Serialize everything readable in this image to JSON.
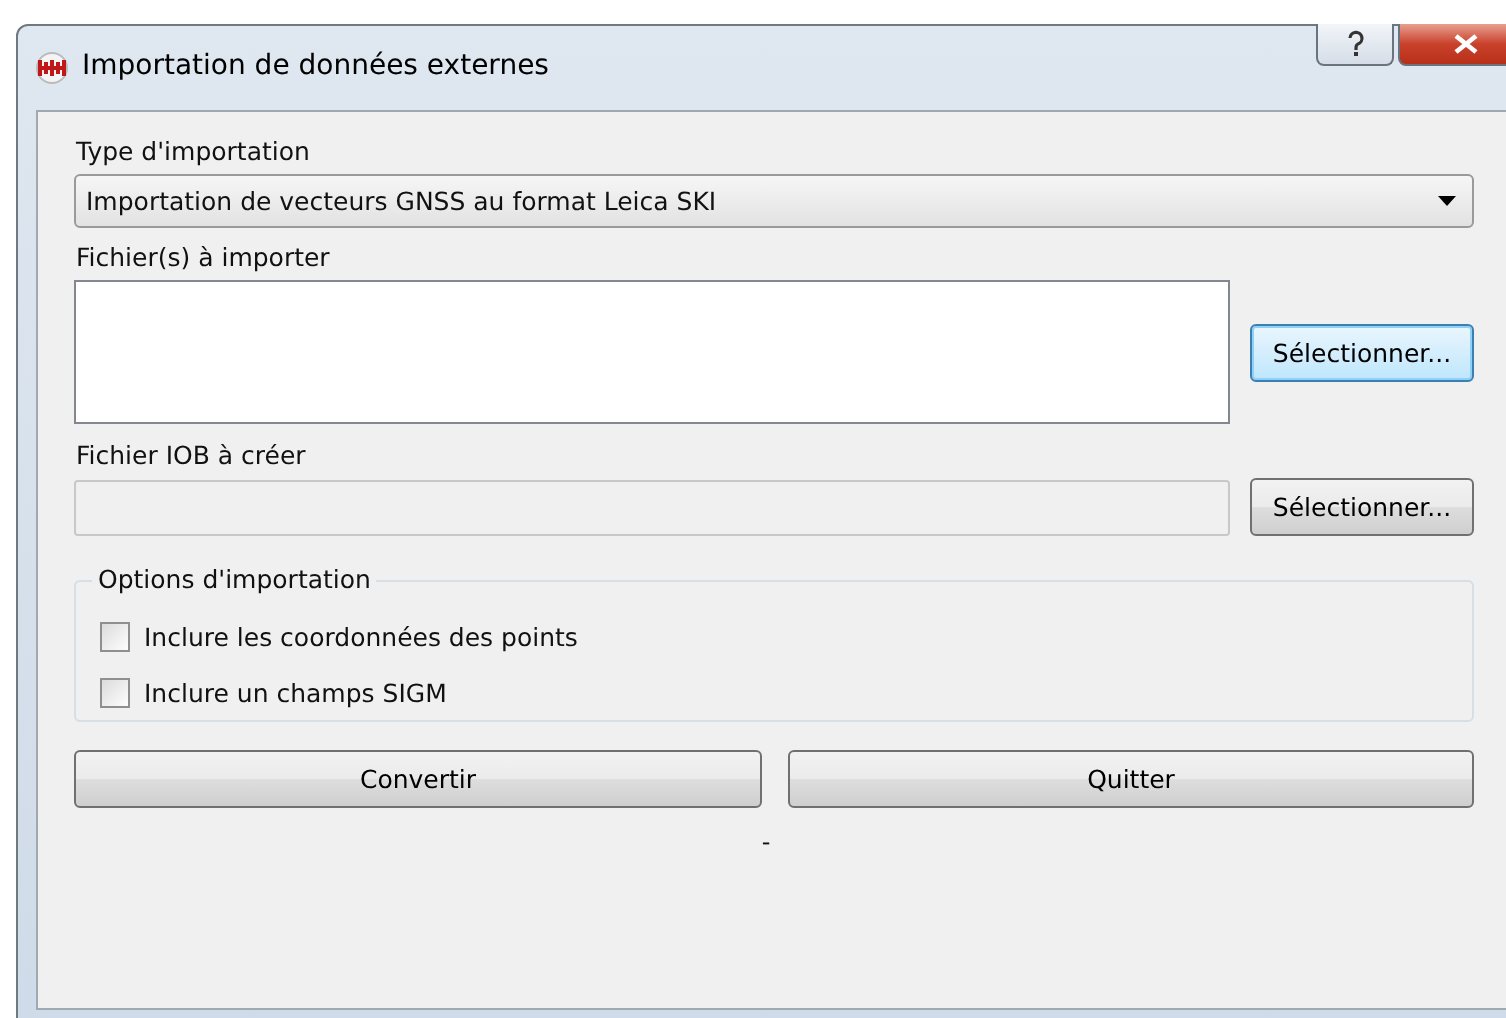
{
  "window": {
    "title": "Importation de données externes"
  },
  "import_type": {
    "label": "Type d'importation",
    "value": "Importation de vecteurs GNSS au format Leica SKI"
  },
  "files_to_import": {
    "label": "Fichier(s) à importer",
    "button": "Sélectionner...",
    "button_focused": true
  },
  "iob_file": {
    "label": "Fichier IOB à créer",
    "disabled": true,
    "button": "Sélectionner...",
    "button_focused": false
  },
  "options": {
    "title": "Options d'importation",
    "items": [
      {
        "label": "Inclure les coordonnées des points",
        "checked": false
      },
      {
        "label": "Inclure un champs SIGM",
        "checked": false
      }
    ]
  },
  "buttons": [
    "Convertir",
    "Quitter"
  ],
  "status": "-"
}
